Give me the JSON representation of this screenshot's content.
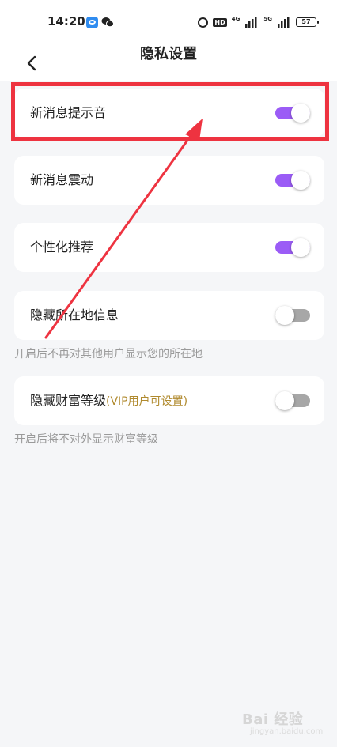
{
  "status_bar": {
    "time": "14:20",
    "network_1": "4G",
    "network_2": "5G",
    "battery": "57"
  },
  "header": {
    "title": "隐私设置"
  },
  "settings": [
    {
      "label": "新消息提示音",
      "enabled": true
    },
    {
      "label": "新消息震动",
      "enabled": true
    },
    {
      "label": "个性化推荐",
      "enabled": true
    },
    {
      "label": "隐藏所在地信息",
      "enabled": false,
      "hint": "开启后不再对其他用户显示您的所在地"
    },
    {
      "label": "隐藏财富等级",
      "note": "(VIP用户可设置)",
      "enabled": false,
      "hint": "开启后将不对外显示财富等级"
    }
  ],
  "colors": {
    "toggle_on": "#9b5cf6",
    "toggle_off": "#a7a7a7",
    "annotation": "#ee3340",
    "vip_note": "#b08a2e"
  },
  "watermark": {
    "text": "Bai 经验",
    "sub": "jingyan.baidu.com"
  }
}
